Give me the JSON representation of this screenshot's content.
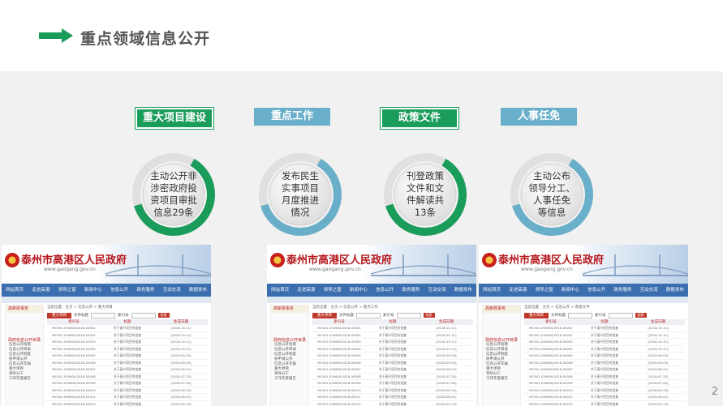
{
  "slide": {
    "title": "重点领域信息公开",
    "page_number": "2",
    "colors": {
      "green": "#1a9c5a",
      "blue": "#6aafca",
      "ring_gray": "#d9d9d9"
    }
  },
  "categories": [
    {
      "tag": "重大项目建设",
      "style": "green",
      "ring_color": "#1a9c5a",
      "lines": [
        "主动公开非",
        "涉密政府投",
        "资项目审批",
        "信息29条"
      ]
    },
    {
      "tag": "重点工作",
      "style": "blue",
      "ring_color": "#6aafca",
      "lines": [
        "发布民生",
        "实事项目",
        "月度推进",
        "情况"
      ]
    },
    {
      "tag": "政策文件",
      "style": "green",
      "ring_color": "#1a9c5a",
      "lines": [
        "刊登政策",
        "文件和文",
        "件解读共",
        "13条"
      ]
    },
    {
      "tag": "人事任免",
      "style": "blue",
      "ring_color": "#6aafca",
      "lines": [
        "主动公布",
        "领导分工、",
        "人事任免",
        "等信息"
      ]
    }
  ],
  "screenshot": {
    "gov_name": "泰州市高港区人民政府",
    "gov_url": "www.gaogang.gov.cn",
    "nav": [
      "网站首页",
      "走进高港",
      "领导之窗",
      "新闻中心",
      "信息公开",
      "政务服务",
      "互动交流",
      "数据发布"
    ],
    "sidebar_header": "高新政事务",
    "sidebar_title": "政府信息公开目录",
    "sidebar_items": [
      "信息公开指南",
      "信息公开目录",
      "信息公开制度",
      "依申请公开",
      "信息公开年报",
      "重大项目",
      "领导分工",
      "工作年度报告"
    ],
    "tab_label": "重大项目",
    "search_label": "文件标题",
    "search_label2": "索引号",
    "search_button": "检索",
    "columns": [
      "索引号",
      "标题",
      "生成日期"
    ],
    "rows": [
      [
        "MC901-030600/2018-00001",
        "关于泰兴项目的批复",
        "[2018-10-11]"
      ],
      [
        "MC901-030600/2018-00002",
        "关于泰兴项目的批复",
        "[2018-10-11]"
      ],
      [
        "MC901-030600/2018-00003",
        "关于泰兴项目的批复",
        "[2018-10-11]"
      ],
      [
        "MC901-030600/2018-00004",
        "关于泰兴项目的批复",
        "[2018-10-11]"
      ],
      [
        "MC901-030600/2018-00005",
        "关于泰兴项目的批复",
        "[2018-09-03]"
      ],
      [
        "MC901-030600/2018-00006",
        "关于泰兴项目的批复",
        "[2018-09-03]"
      ],
      [
        "MC901-030600/2018-00007",
        "关于泰兴项目的批复",
        "[2018-08-21]"
      ],
      [
        "MC901-030600/2018-00008",
        "关于泰兴项目的批复",
        "[2018-07-25]"
      ],
      [
        "MC901-030600/2018-00009",
        "关于泰兴项目的批复",
        "[2018-07-05]"
      ],
      [
        "MC901-030600/2018-00010",
        "关于泰兴项目的批复",
        "[2018-06-20]"
      ],
      [
        "MC901-030600/2018-00011",
        "关于泰兴项目的批复",
        "[2018-06-01]"
      ],
      [
        "MC901-030600/2018-00012",
        "关于泰兴项目的批复",
        "[2018-05-15]"
      ],
      [
        "MC901-030600/2018-00013",
        "关于泰兴项目的批复",
        "[2018-05-01]"
      ]
    ],
    "crumbs": [
      "当前位置：主页 > 信息公开 > 重大项目",
      "当前位置：主页 > 信息公开 > 重点工作",
      "当前位置：主页 > 信息公开 > 政策文件"
    ]
  }
}
